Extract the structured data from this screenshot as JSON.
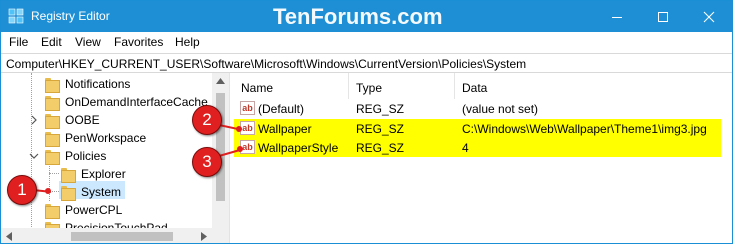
{
  "window": {
    "title": "Registry Editor",
    "watermark": "TenForums.com",
    "accent": "#1e8fd5"
  },
  "menu": [
    "File",
    "Edit",
    "View",
    "Favorites",
    "Help"
  ],
  "address": "Computer\\HKEY_CURRENT_USER\\Software\\Microsoft\\Windows\\CurrentVersion\\Policies\\System",
  "tree": {
    "items": [
      {
        "label": "Notifications",
        "expanded": false
      },
      {
        "label": "OnDemandInterfaceCache",
        "expanded": false
      },
      {
        "label": "OOBE",
        "expanded": false
      },
      {
        "label": "PenWorkspace",
        "expanded": false
      },
      {
        "label": "Policies",
        "expanded": true
      },
      {
        "label": "Explorer",
        "expanded": false
      },
      {
        "label": "System",
        "expanded": false,
        "selected": true
      },
      {
        "label": "PowerCPL",
        "expanded": false
      },
      {
        "label": "PrecisionTouchPad",
        "expanded": false
      }
    ]
  },
  "list": {
    "columns": [
      "Name",
      "Type",
      "Data"
    ],
    "rows": [
      {
        "name": "(Default)",
        "type": "REG_SZ",
        "data": "(value not set)",
        "highlight": false
      },
      {
        "name": "Wallpaper",
        "type": "REG_SZ",
        "data": "C:\\Windows\\Web\\Wallpaper\\Theme1\\img3.jpg",
        "highlight": true
      },
      {
        "name": "WallpaperStyle",
        "type": "REG_SZ",
        "data": "4",
        "highlight": true
      }
    ],
    "value_icon_text": "ab",
    "highlight_color": "#ffff00"
  },
  "callouts": [
    "1",
    "2",
    "3"
  ],
  "callout_color": "#e02020"
}
